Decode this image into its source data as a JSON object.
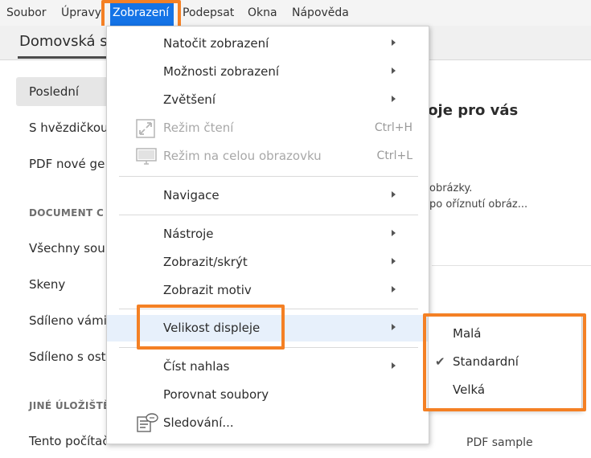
{
  "menubar": {
    "items": [
      "Soubor",
      "Úpravy",
      "Zobrazení",
      "Podepsat",
      "Okna",
      "Nápověda"
    ]
  },
  "tabs": {
    "home": "Domovská st"
  },
  "sidebar": {
    "items": [
      "Poslední",
      "S hvězdičkou",
      "PDF nové ge"
    ],
    "section1": "DOCUMENT C",
    "section1_items": [
      "Všechny soub",
      "Skeny",
      "Sdíleno vámi",
      "Sdíleno s ost"
    ],
    "section2": "JINÉ ÚLOŽIŠTĚ",
    "section2_items": [
      "Tento počítač"
    ]
  },
  "content": {
    "title": "stroje pro vás",
    "line1": "obrázky.",
    "line2": "po oříznutí obráz...",
    "bottom": "PDF sample"
  },
  "menu": {
    "items": [
      {
        "label": "Natočit zobrazení",
        "submenu": true
      },
      {
        "label": "Možnosti zobrazení",
        "submenu": true
      },
      {
        "label": "Zvětšení",
        "submenu": true
      },
      {
        "label": "Režim čtení",
        "shortcut": "Ctrl+H",
        "disabled": true,
        "icon": "reading-mode-icon"
      },
      {
        "label": "Režim na celou obrazovku",
        "shortcut": "Ctrl+L",
        "disabled": true,
        "icon": "full-screen-icon"
      },
      {
        "label": "Navigace",
        "submenu": true
      },
      {
        "label": "Nástroje",
        "submenu": true
      },
      {
        "label": "Zobrazit/skrýt",
        "submenu": true
      },
      {
        "label": "Zobrazit motiv",
        "submenu": true
      },
      {
        "label": "Velikost displeje",
        "submenu": true,
        "highlighted": true
      },
      {
        "label": "Číst nahlas",
        "submenu": true
      },
      {
        "label": "Porovnat soubory"
      },
      {
        "label": "Sledování...",
        "icon": "tracker-icon"
      }
    ]
  },
  "submenu": {
    "items": [
      {
        "label": "Malá",
        "checked": false
      },
      {
        "label": "Standardní",
        "checked": true
      },
      {
        "label": "Velká",
        "checked": false
      }
    ],
    "check_glyph": "✔"
  },
  "colors": {
    "accent": "#1473e6",
    "highlight_box": "#f48024",
    "hover": "#e7f0fb"
  }
}
